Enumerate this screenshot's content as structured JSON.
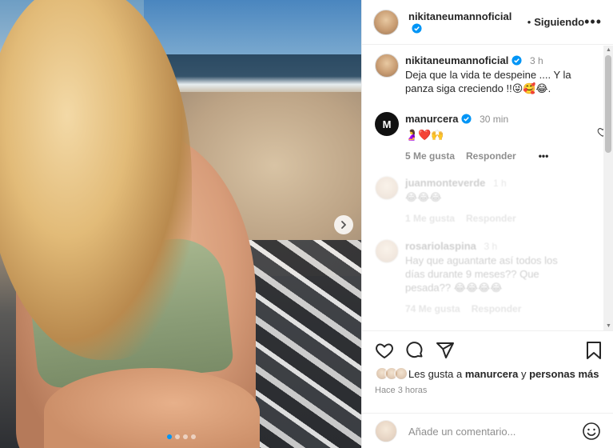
{
  "post": {
    "author": "nikitaneumannoficial",
    "follow_status": "Siguiendo",
    "separator": "•",
    "more_label": "•••",
    "caption_line1": "Deja que la vida te despeine .... Y la",
    "caption_line2": "panza siga creciendo !!😜🥰😂.",
    "caption_time": "3 h",
    "carousel_dots": 4,
    "active_dot": 0
  },
  "comments": [
    {
      "user": "manurcera",
      "time": "30 min",
      "text": "🤰❤️🙌",
      "likes": "5 Me gusta",
      "reply": "Responder",
      "more": "•••",
      "avatar_letter": "M"
    },
    {
      "user": "juanmonteverde",
      "time": "1 h",
      "text": "😂😂😂",
      "likes": "1 Me gusta",
      "reply": "Responder"
    },
    {
      "user": "rosariolaspina",
      "time": "3 h",
      "text_line1": "Hay que aguantarte así todos los",
      "text_line2": "días durante 9 meses?? Que",
      "text_line3": "pesada?? 😂😂😂😂",
      "likes": "74 Me gusta",
      "reply": "Responder"
    }
  ],
  "likes_summary": {
    "prefix": "Les gusta a ",
    "user": "manurcera",
    "mid": " y ",
    "rest": "personas más"
  },
  "timestamp": "Hace 3 horas",
  "add_comment": {
    "placeholder": "Añade un comentario..."
  },
  "icons": [
    "heart-icon",
    "comment-icon",
    "share-icon",
    "bookmark-icon",
    "emoji-icon",
    "verified-icon",
    "chevron-right-icon"
  ],
  "colors": {
    "verified": "#0095f6",
    "heart_red": "#ed4956",
    "muted": "#8e8e8e"
  }
}
